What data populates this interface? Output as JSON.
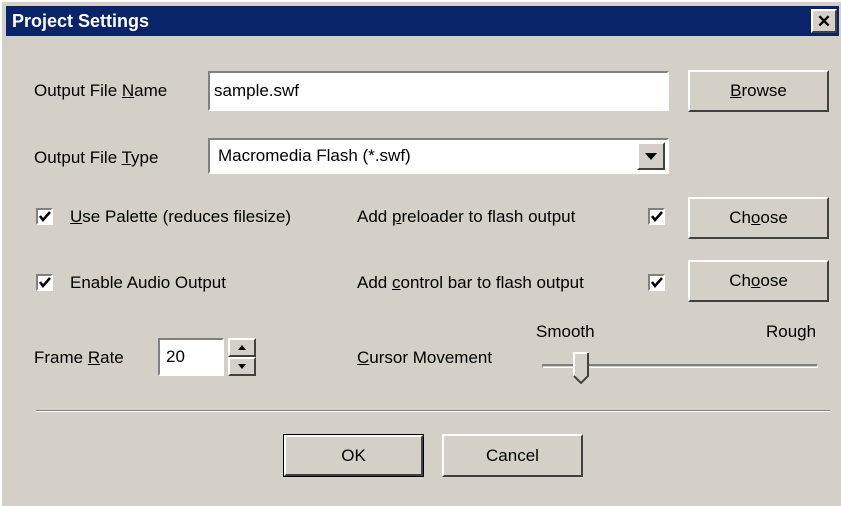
{
  "window": {
    "title": "Project Settings",
    "close_label": "✕"
  },
  "output_file_name": {
    "label_pre": "Output File ",
    "label_key": "N",
    "label_post": "ame",
    "value": "sample.swf",
    "browse_pre": "",
    "browse_key": "B",
    "browse_post": "rowse"
  },
  "output_file_type": {
    "label_pre": "Output File ",
    "label_key": "T",
    "label_post": "ype",
    "selected": "Macromedia Flash (*.swf)"
  },
  "use_palette": {
    "key": "U",
    "rest": "se Palette (reduces filesize)",
    "checked": true
  },
  "enable_audio": {
    "label": "Enable Audio Output",
    "checked": true
  },
  "preloader": {
    "label_pre": "Add ",
    "label_key": "p",
    "label_post": "reloader to flash output",
    "checked": true,
    "choose_pre": "Ch",
    "choose_key": "o",
    "choose_post": "ose"
  },
  "control_bar": {
    "label_pre": "Add ",
    "label_key": "c",
    "label_post": "ontrol bar to flash output",
    "checked": true,
    "choose_pre": "Ch",
    "choose_key": "o",
    "choose_post": "ose"
  },
  "frame_rate": {
    "label_pre": "Frame ",
    "label_key": "R",
    "label_post": "ate",
    "value": "20"
  },
  "cursor_movement": {
    "label_key": "C",
    "label_post": "ursor Movement",
    "min_label": "Smooth",
    "max_label": "Rough",
    "value_fraction": 0.12
  },
  "buttons": {
    "ok": "OK",
    "cancel": "Cancel"
  },
  "colors": {
    "face": "#d4d0c8",
    "titlebar": "#0a246a",
    "title_text": "#ffffff"
  }
}
